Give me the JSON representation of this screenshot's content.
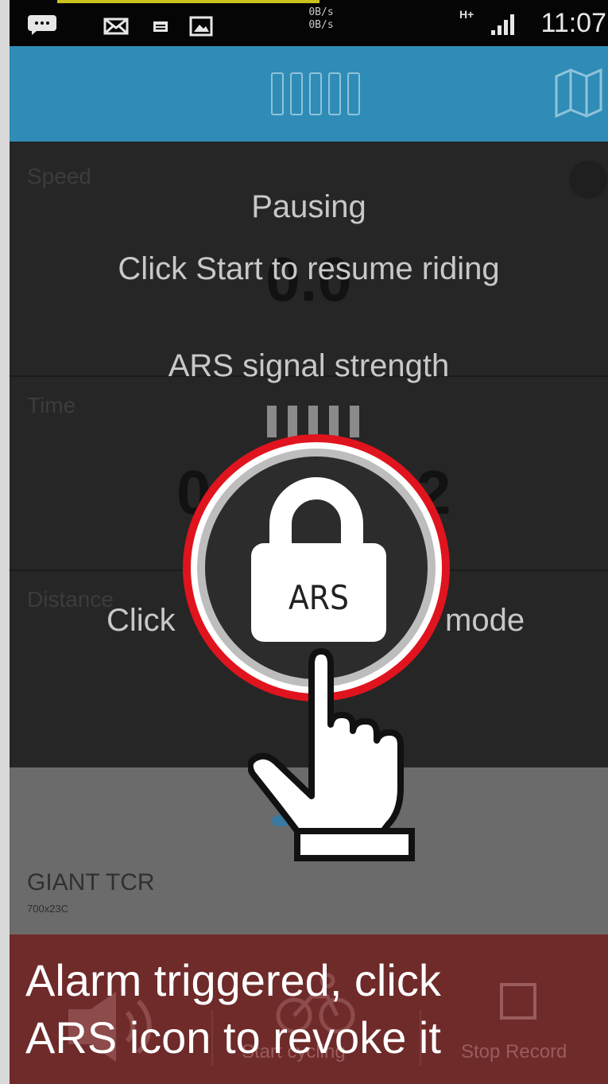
{
  "status_bar": {
    "speed_up": "0B/s",
    "speed_down": "0B/s",
    "network": "H+",
    "time": "11:07",
    "icons": [
      "message-icon",
      "mail-icon",
      "sms-icon",
      "image-icon",
      "signal-icon"
    ]
  },
  "app_bar": {
    "icons": [
      "ars-signal-bars-icon",
      "map-icon"
    ],
    "accent": "#2f8cb6"
  },
  "panels": {
    "speed_label": "Speed",
    "speed_value": "0.0",
    "time_label": "Time",
    "time_value_left": "0",
    "time_value_right": "2",
    "distance_label": "Distance"
  },
  "overlay": {
    "pausing": "Pausing",
    "resume_hint": "Click Start to resume riding",
    "signal_label": "ARS signal strength",
    "mode_hint_left": "Click",
    "mode_hint_right": "mode"
  },
  "ars_button": {
    "label": "ARS",
    "ring_color": "#e0141e"
  },
  "device": {
    "name": "GIANT TCR",
    "tire": "700x23C"
  },
  "bottom_bar": {
    "alarm_line1": "Alarm triggered, click",
    "alarm_line2": "ARS icon to revoke it",
    "left_label": "",
    "center_label": "Start cycling",
    "right_label": "Stop Record",
    "alarm_color": "#6f2a2a"
  }
}
